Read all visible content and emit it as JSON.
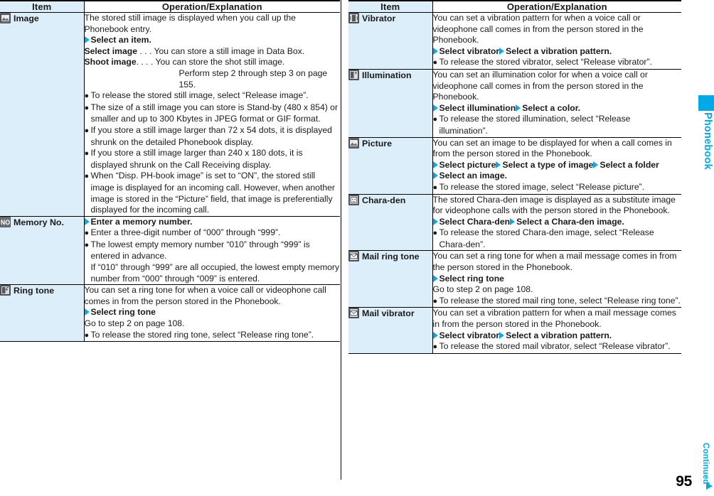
{
  "page": {
    "number": "95",
    "continued_label": "Continued",
    "thumb_tab_label": "Phonebook",
    "accent_color": "#00a9e8",
    "item_cell_bg": "#ddeefb"
  },
  "columns": [
    {
      "header": {
        "item": "Item",
        "operation": "Operation/Explanation"
      },
      "rows": [
        {
          "icon": "picture-icon",
          "item": "Image",
          "blocks": [
            {
              "kind": "para",
              "text": "The stored still image is displayed when you call up the Phonebook entry."
            },
            {
              "kind": "step",
              "parts": [
                {
                  "arrow": true,
                  "bold": "Select an item."
                }
              ]
            },
            {
              "kind": "dotted",
              "term": "Select image",
              "dots": " . . . ",
              "text": "You can store a still image in Data Box."
            },
            {
              "kind": "dotted",
              "term": "Shoot image",
              "dots": ". . . . ",
              "text": "You can store the shot still image."
            },
            {
              "kind": "deep",
              "text": "Perform step 2 through step 3 on page 155."
            },
            {
              "kind": "bullet",
              "text": "To release the stored still image, select “Release image”."
            },
            {
              "kind": "bullet",
              "text": "The size of a still image you can store is Stand-by (480 x 854) or smaller and up to 300 Kbytes in JPEG format or GIF format."
            },
            {
              "kind": "bullet",
              "text": "If you store a still image larger than 72 x 54 dots, it is displayed shrunk on the detailed Phonebook display."
            },
            {
              "kind": "bullet",
              "text": "If you store a still image larger than 240 x 180 dots, it is displayed shrunk on the Call Receiving display."
            },
            {
              "kind": "bullet",
              "text": "When “Disp. PH-book image” is set to “ON”, the stored still image is displayed for an incoming call. However, when another image is stored in the “Picture” field, that image is preferentially displayed for the incoming call."
            }
          ]
        },
        {
          "icon": "memory-no-icon",
          "item": "Memory No.",
          "blocks": [
            {
              "kind": "step",
              "parts": [
                {
                  "arrow": true,
                  "bold": "Enter a memory number."
                }
              ]
            },
            {
              "kind": "bullet",
              "text": "Enter a three-digit number of “000” through “999”."
            },
            {
              "kind": "bullet",
              "text": "The lowest empty memory number “010” through “999” is entered in advance."
            },
            {
              "kind": "bullet-cont",
              "text": "If “010” through “999” are all occupied, the lowest empty memory number from “000” through “009” is entered."
            }
          ]
        },
        {
          "icon": "ring-tone-icon",
          "item": "Ring tone",
          "blocks": [
            {
              "kind": "para",
              "text": "You can set a ring tone for when a voice call or videophone call comes in from the person stored in the Phonebook."
            },
            {
              "kind": "step",
              "parts": [
                {
                  "arrow": true,
                  "bold": "Select ring tone"
                }
              ]
            },
            {
              "kind": "para",
              "text": "Go to step 2 on page 108."
            },
            {
              "kind": "bullet",
              "text": "To release the stored ring tone, select “Release ring tone”."
            }
          ]
        }
      ]
    },
    {
      "header": {
        "item": "Item",
        "operation": "Operation/Explanation"
      },
      "rows": [
        {
          "icon": "vibrator-icon",
          "item": "Vibrator",
          "blocks": [
            {
              "kind": "para",
              "text": "You can set a vibration pattern for when a voice call or videophone call comes in from the person stored in the Phonebook."
            },
            {
              "kind": "step",
              "parts": [
                {
                  "arrow": true,
                  "bold": "Select vibrator"
                },
                {
                  "arrow": true,
                  "bold": "Select a vibration pattern."
                }
              ]
            },
            {
              "kind": "bullet",
              "text": "To release the stored vibrator, select “Release vibrator”."
            }
          ]
        },
        {
          "icon": "illumination-icon",
          "item": "Illumination",
          "blocks": [
            {
              "kind": "para",
              "text": "You can set an illumination color for when a voice call or videophone call comes in from the person stored in the Phonebook."
            },
            {
              "kind": "step",
              "parts": [
                {
                  "arrow": true,
                  "bold": "Select illumination"
                },
                {
                  "arrow": true,
                  "bold": "Select a color."
                }
              ]
            },
            {
              "kind": "bullet",
              "text": "To release the stored illumination, select “Release illumination”."
            }
          ]
        },
        {
          "icon": "picture-icon",
          "item": "Picture",
          "blocks": [
            {
              "kind": "para",
              "text": "You can set an image to be displayed for when a call comes in from the person stored in the Phonebook."
            },
            {
              "kind": "step",
              "parts": [
                {
                  "arrow": true,
                  "bold": "Select picture"
                },
                {
                  "arrow": true,
                  "bold": "Select a type of image"
                },
                {
                  "arrow": true,
                  "bold": "Select a folder"
                }
              ]
            },
            {
              "kind": "step",
              "parts": [
                {
                  "arrow": true,
                  "bold": "Select an image."
                }
              ]
            },
            {
              "kind": "bullet",
              "text": "To release the stored image, select “Release picture”."
            }
          ]
        },
        {
          "icon": "chara-den-icon",
          "item": "Chara-den",
          "blocks": [
            {
              "kind": "para",
              "text": "The stored Chara-den image is displayed as a substitute image for videophone calls with the person stored in the Phonebook."
            },
            {
              "kind": "step",
              "parts": [
                {
                  "arrow": true,
                  "bold": "Select Chara-den"
                },
                {
                  "arrow": true,
                  "bold": "Select a Chara-den image."
                }
              ]
            },
            {
              "kind": "bullet",
              "text": "To release the stored Chara-den image, select “Release Chara-den”."
            }
          ]
        },
        {
          "icon": "mail-ring-tone-icon",
          "item": "Mail ring tone",
          "blocks": [
            {
              "kind": "para",
              "text": "You can set a ring tone for when a mail message comes in from the person stored in the Phonebook."
            },
            {
              "kind": "step",
              "parts": [
                {
                  "arrow": true,
                  "bold": "Select ring tone"
                }
              ]
            },
            {
              "kind": "para",
              "text": "Go to step 2 on page 108."
            },
            {
              "kind": "bullet",
              "text": "To release the stored mail ring tone, select “Release ring tone”."
            }
          ]
        },
        {
          "icon": "mail-vibrator-icon",
          "item": "Mail vibrator",
          "blocks": [
            {
              "kind": "para",
              "text": "You can set a vibration pattern for when a mail message comes in from the person stored in the Phonebook."
            },
            {
              "kind": "step",
              "parts": [
                {
                  "arrow": true,
                  "bold": "Select vibrator"
                },
                {
                  "arrow": true,
                  "bold": "Select a vibration pattern."
                }
              ]
            },
            {
              "kind": "bullet",
              "text": "To release the stored mail vibrator, select “Release vibrator”."
            }
          ]
        }
      ]
    }
  ]
}
